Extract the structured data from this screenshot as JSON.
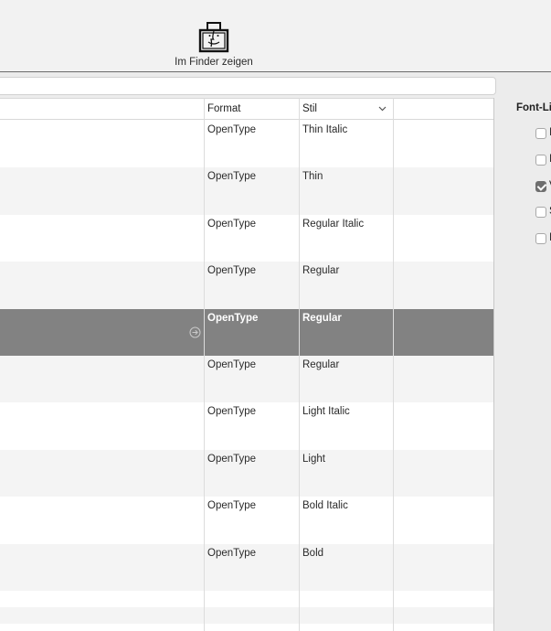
{
  "toolbar": {
    "finder_button_label": "Im Finder zeigen",
    "finder_icon": "finder-icon"
  },
  "search": {
    "placeholder": "",
    "value": ""
  },
  "table": {
    "columns": [
      {
        "key": "format",
        "label": "Format"
      },
      {
        "key": "style",
        "label": "Stil"
      }
    ],
    "sort_icon": "chevron-down-icon",
    "rows": [
      {
        "format": "OpenType",
        "style": "Thin Italic",
        "selected": false
      },
      {
        "format": "OpenType",
        "style": "Thin",
        "selected": false
      },
      {
        "format": "OpenType",
        "style": "Regular Italic",
        "selected": false
      },
      {
        "format": "OpenType",
        "style": "Regular",
        "selected": false
      },
      {
        "format": "OpenType",
        "style": "Regular",
        "selected": true
      },
      {
        "format": "OpenType",
        "style": "Regular",
        "selected": false
      },
      {
        "format": "OpenType",
        "style": "Light Italic",
        "selected": false
      },
      {
        "format": "OpenType",
        "style": "Light",
        "selected": false
      },
      {
        "format": "OpenType",
        "style": "Bold Italic",
        "selected": false
      },
      {
        "format": "OpenType",
        "style": "Bold",
        "selected": false
      }
    ],
    "selected_row_icon": "arrow-circle-right-icon"
  },
  "sidebar": {
    "title": "Font-Li",
    "checkboxes": [
      {
        "label": "I",
        "checked": false
      },
      {
        "label": "I",
        "checked": false
      },
      {
        "label": "V",
        "checked": true
      },
      {
        "label": "S",
        "checked": false
      },
      {
        "label": "I",
        "checked": false
      }
    ]
  },
  "colors": {
    "selection": "#828282",
    "alt_row": "#f4f4f4",
    "background": "#ececec"
  }
}
